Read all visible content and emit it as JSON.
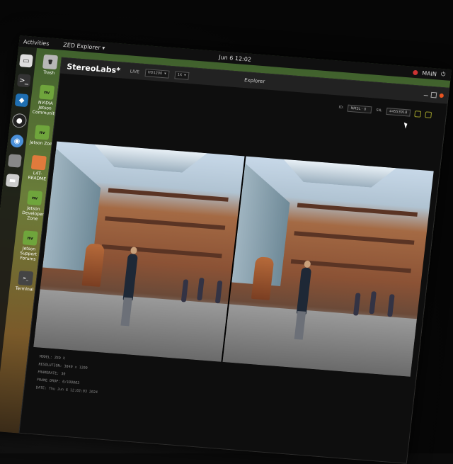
{
  "topbar": {
    "activities": "Activities",
    "app_menu": "ZED Explorer ▾",
    "clock": "Jun 6 12:02",
    "user": "MAIN"
  },
  "desktop_icons": [
    {
      "label": "Trash"
    },
    {
      "label": "NVIDIA Jetson Community"
    },
    {
      "label": "Jetson Zoo"
    },
    {
      "label": "L4T-README"
    },
    {
      "label": "Jetson Developer Zone"
    },
    {
      "label": "Jetson Support Forums"
    },
    {
      "label": "Terminal"
    }
  ],
  "window": {
    "brand": "StereoLabs*",
    "live": "LIVE",
    "resolution_select": "HD1200",
    "fps_select": "1X",
    "title": "Explorer"
  },
  "toolbar": {
    "serial_label": "ID:",
    "serial_value": "NMSL · 0",
    "sn_label": "SN:",
    "sn_value": "44553918"
  },
  "info": {
    "model": "MODEL: ZED X",
    "resolution": "RESOLUTION: 3840 x 1200",
    "framerate": "FRAMERATE: 30",
    "frame_drop": "FRAME DROP: 0/100003",
    "date": "DATE: Thu Jun 6 12:02:03 2024"
  },
  "colors": {
    "accent_close": "#e95420",
    "wallpaper_green": "#3d5f2c"
  }
}
